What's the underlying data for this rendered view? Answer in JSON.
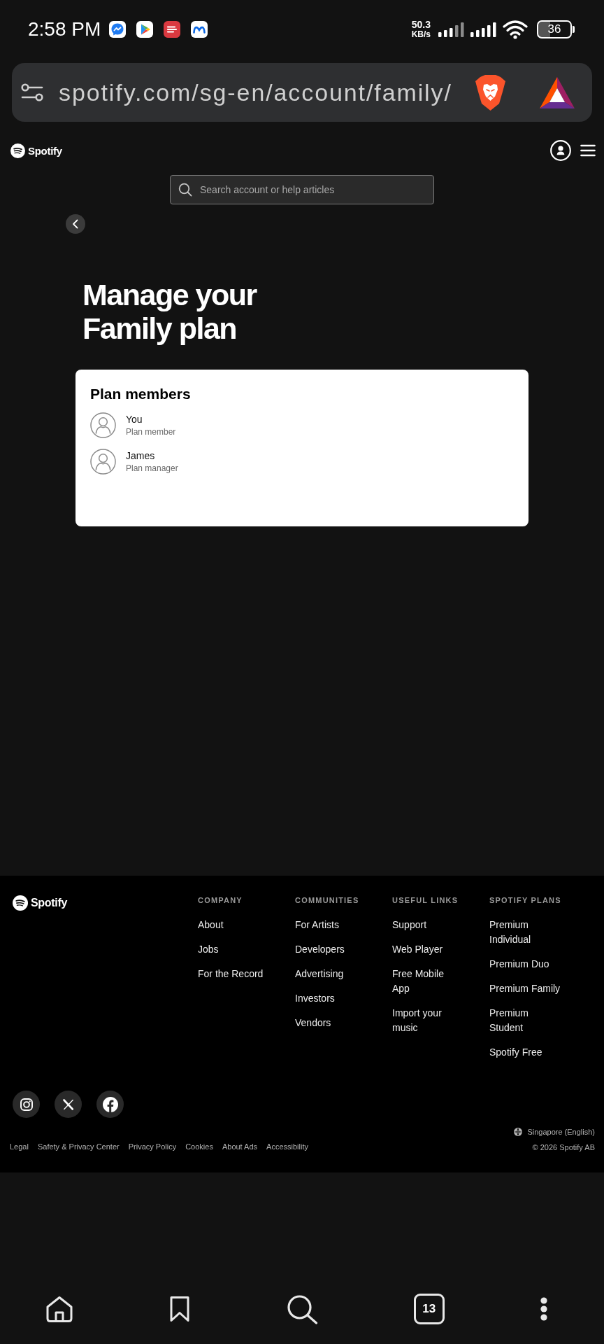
{
  "status_bar": {
    "time": "2:58 PM",
    "speed_value": "50.3",
    "speed_unit": "KB/s",
    "battery": "36"
  },
  "address_bar": {
    "url": "spotify.com/sg-en/account/family/"
  },
  "header": {
    "logo_text": "Spotify"
  },
  "search": {
    "placeholder": "Search account or help articles"
  },
  "page": {
    "title": "Manage your Family plan"
  },
  "members_card": {
    "title": "Plan members",
    "members": [
      {
        "name": "You",
        "role": "Plan member"
      },
      {
        "name": "James",
        "role": "Plan manager"
      }
    ]
  },
  "footer": {
    "logo_text": "Spotify",
    "columns": [
      {
        "heading": "COMPANY",
        "links": [
          "About",
          "Jobs",
          "For the Record"
        ]
      },
      {
        "heading": "COMMUNITIES",
        "links": [
          "For Artists",
          "Developers",
          "Advertising",
          "Investors",
          "Vendors"
        ]
      },
      {
        "heading": "USEFUL LINKS",
        "links": [
          "Support",
          "Web Player",
          "Free Mobile App",
          "Import your music"
        ]
      },
      {
        "heading": "SPOTIFY PLANS",
        "links": [
          "Premium Individual",
          "Premium Duo",
          "Premium Family",
          "Premium Student",
          "Spotify Free"
        ]
      }
    ],
    "legal_links": [
      "Legal",
      "Safety & Privacy Center",
      "Privacy Policy",
      "Cookies",
      "About Ads",
      "Accessibility"
    ],
    "region": "Singapore (English)",
    "copyright": "© 2026 Spotify AB"
  },
  "bottom_bar": {
    "tab_count": "13"
  }
}
